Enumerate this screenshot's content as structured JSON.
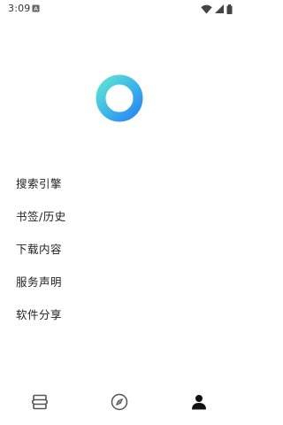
{
  "status_bar": {
    "time": "3:09",
    "icons": [
      "notification-a-icon",
      "wifi-icon",
      "cell-signal-icon",
      "battery-icon"
    ]
  },
  "logo": {
    "icon": "ring-logo-icon",
    "colors": [
      "#4fd6d6",
      "#2b8ff0"
    ]
  },
  "menu": {
    "items": [
      {
        "label": "搜索引擎"
      },
      {
        "label": "书签/历史"
      },
      {
        "label": "下载内容"
      },
      {
        "label": "服务声明"
      },
      {
        "label": "软件分享"
      }
    ]
  },
  "bottom_nav": {
    "items": [
      {
        "icon": "tabs-stack-icon",
        "active": false
      },
      {
        "icon": "compass-icon",
        "active": false
      },
      {
        "icon": "person-icon",
        "active": true
      }
    ],
    "colors": {
      "inactive": "#555555",
      "active": "#111111"
    }
  }
}
